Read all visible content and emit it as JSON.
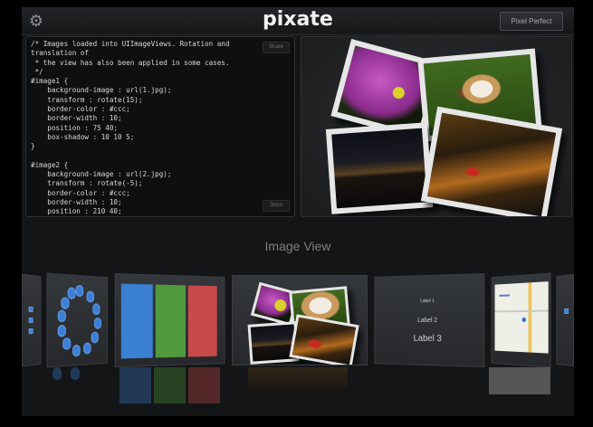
{
  "app": {
    "logo": "pixate",
    "pixel_perfect_label": "Pixel Perfect",
    "settings_icon": "gear-icon"
  },
  "editor": {
    "code": "/* Images loaded into UIImageViews. Rotation and\ntranslation of\n * the view has also been applied in some cases.\n */\n#image1 {\n    background-image : url(1.jpg);\n    transform : rotate(15);\n    border-color : #ccc;\n    border-width : 10;\n    position : 75 40;\n    box-shadow : 10 10 5;\n}\n\n#image2 {\n    background-image : url(2.jpg);\n    transform : rotate(-5);\n    border-color : #ccc;\n    border-width : 10;\n    position : 210 40;",
    "share_label": "Share",
    "docs_label": "Docs"
  },
  "section_title": "Image View",
  "carousel": {
    "labels_card": {
      "label1": "Label 1",
      "label2": "Label 2",
      "label3": "Label 3"
    },
    "color_card_colors": [
      "#3a7fd0",
      "#4f9a3c",
      "#c94a4a"
    ]
  }
}
